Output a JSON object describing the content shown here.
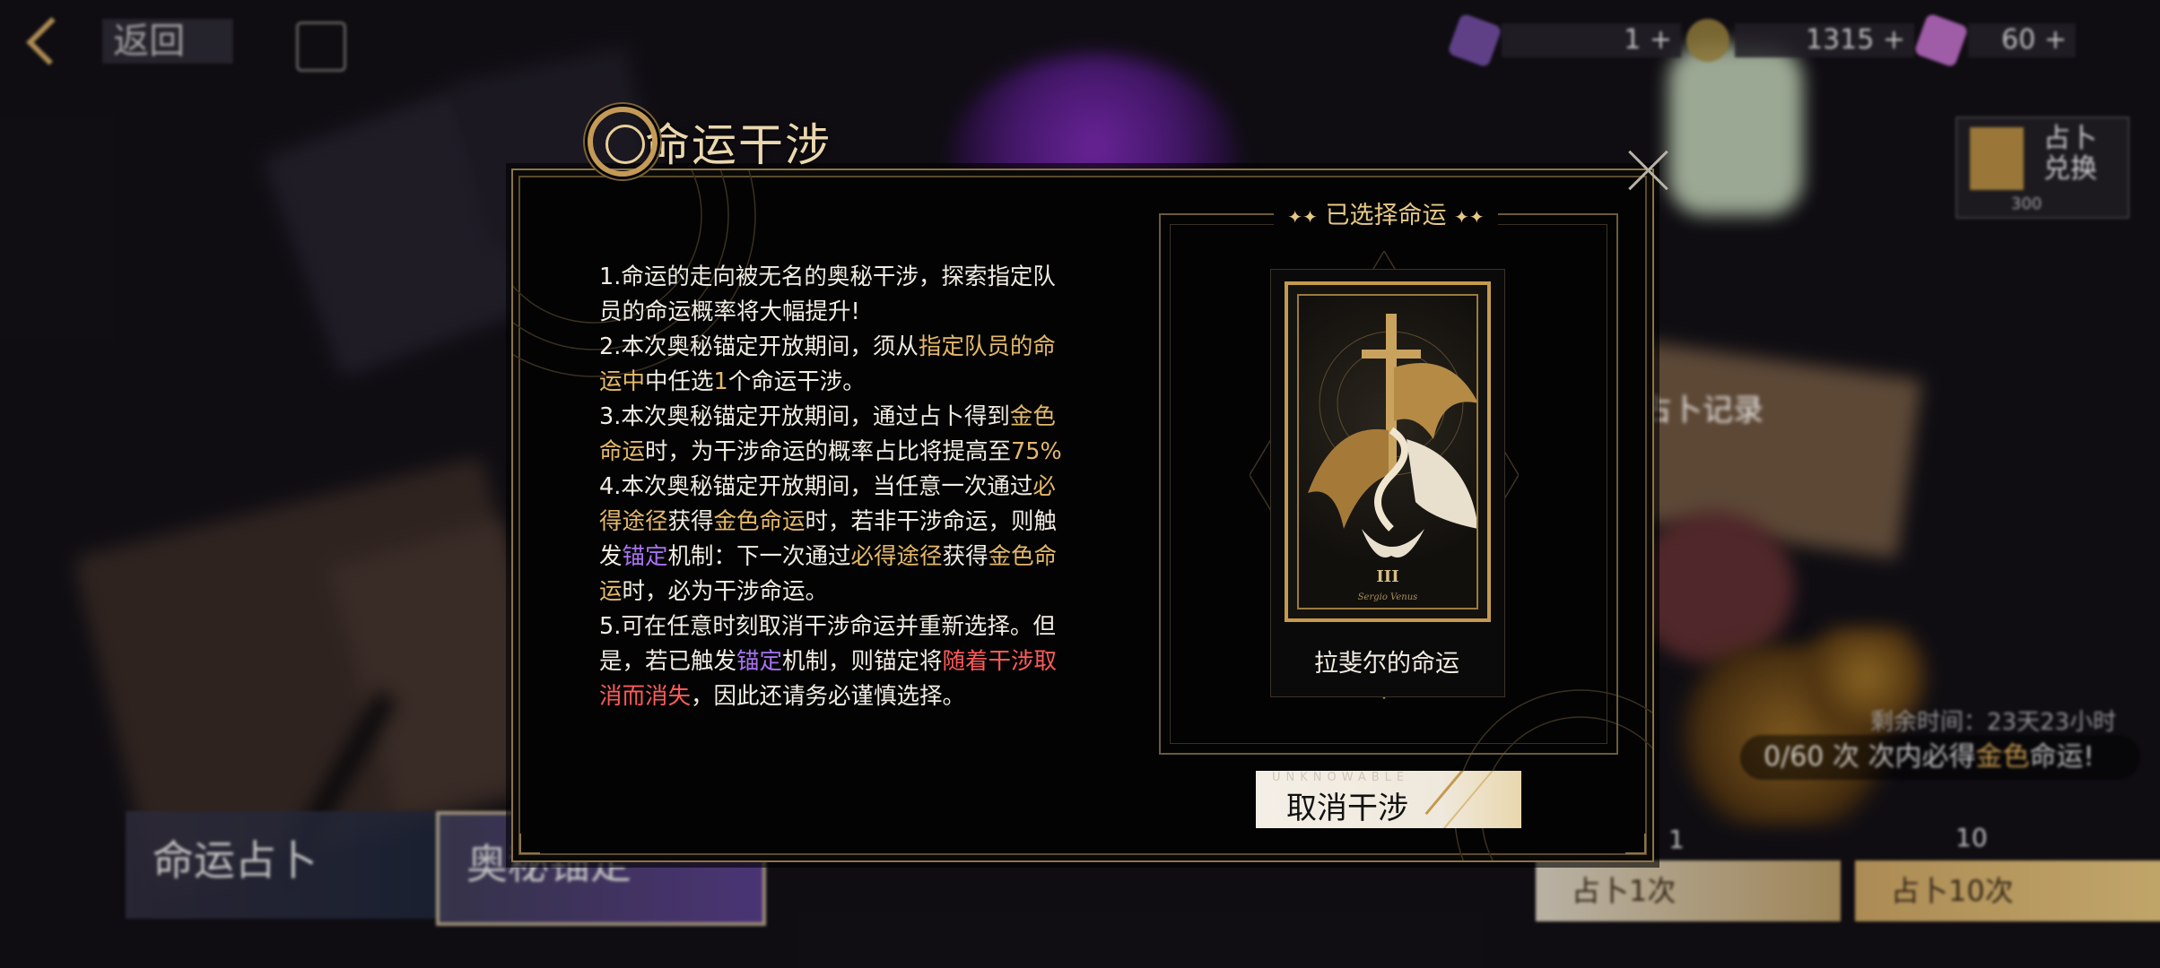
{
  "topbar": {
    "back_label": "返回",
    "resources": [
      {
        "icon": "fate-crystal-icon",
        "value": "1 +"
      },
      {
        "icon": "gold-coin-icon",
        "value": "1315 +"
      },
      {
        "icon": "ticket-icon",
        "value": "60 +"
      }
    ]
  },
  "side_shop": {
    "label_line1": "占卜",
    "label_line2": "兑换",
    "cost": "300"
  },
  "background": {
    "record_label": "占卜记录",
    "timer": "剩余时间：23天23小时",
    "notice_prefix": "0/60 次",
    "notice_middle": "次内必得",
    "notice_gold": "金色",
    "notice_suffix": "命运!",
    "cost_one": "1",
    "cost_ten": "10",
    "draw_one": "占卜1次",
    "draw_ten": "占卜10次",
    "tab_fate": "命运占卜",
    "tab_arcane": "奥秘锚定"
  },
  "modal": {
    "title": "命运干涉",
    "rules": {
      "r1": "1.命运的走向被无名的奥秘干涉，探索指定队员的命运概率将大幅提升!",
      "r2_a": "2.本次奥秘锚定开放期间，须从",
      "r2_b": "指定队员的命运中",
      "r2_c": "中任选",
      "r2_d": "1",
      "r2_e": "个命运干涉。",
      "r3_a": "3.本次奥秘锚定开放期间，通过占卜得到",
      "r3_b": "金色命运",
      "r3_c": "时，为干涉命运的概率占比将提高至",
      "r3_d": "75%",
      "r4_a": "4.本次奥秘锚定开放期间，当任意一次通过",
      "r4_b": "必得途径",
      "r4_c": "获得",
      "r4_d": "金色命运",
      "r4_e": "时，若非干涉命运，则触发",
      "r4_f": "锚定",
      "r4_g": "机制：下一次通过",
      "r4_h": "必得途径",
      "r4_i": "获得",
      "r4_j": "金色命运",
      "r4_k": "时，必为干涉命运。",
      "r5_a": "5.可在任意时刻取消干涉命运并重新选择。但是，若已触发",
      "r5_b": "锚定",
      "r5_c": "机制，则锚定将",
      "r5_d": "随着干涉取消而消失",
      "r5_e": "，因此还请务必谨慎选择。"
    },
    "selected_heading": "已选择命运",
    "card": {
      "roman": "III",
      "subtitle": "Sergio Venus",
      "name": "拉斐尔的命运"
    },
    "cancel_tiny": "UNKNOWABLE",
    "cancel_label": "取消干涉"
  },
  "colors": {
    "gold": "#e4b86a",
    "violet": "#a872f0",
    "red": "#ff5a5a",
    "frame": "#8c7445"
  }
}
